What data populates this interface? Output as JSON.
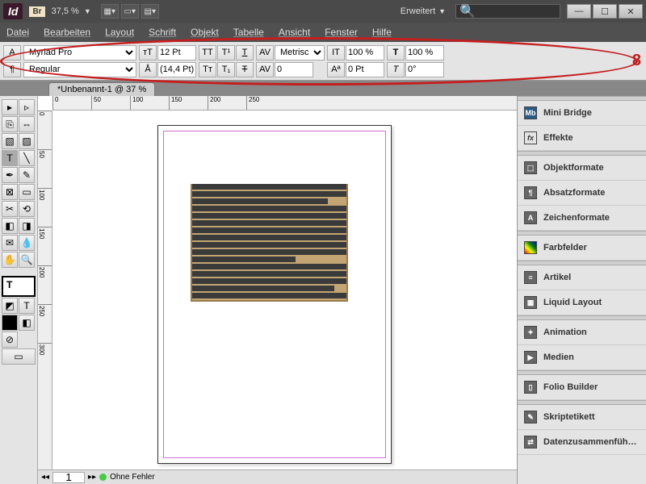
{
  "title": {
    "zoom": "37,5 %",
    "workspace": "Erweitert"
  },
  "menu": {
    "datei": "Datei",
    "bearbeiten": "Bearbeiten",
    "layout": "Layout",
    "schrift": "Schrift",
    "objekt": "Objekt",
    "tabelle": "Tabelle",
    "ansicht": "Ansicht",
    "fenster": "Fenster",
    "hilfe": "Hilfe"
  },
  "control": {
    "font": "Myriad Pro",
    "style": "Regular",
    "size": "12 Pt",
    "leading": "(14,4 Pt)",
    "kerning": "Metrisch",
    "tracking": "0",
    "hscale": "100 %",
    "vscale": "100 %",
    "baseline": "0 Pt",
    "skew": "0°",
    "annotation": "8"
  },
  "tab": {
    "name": "*Unbenannt-1 @ 37 %"
  },
  "ruler": {
    "h": [
      "0",
      "50",
      "100",
      "150",
      "200",
      "250"
    ],
    "v": [
      "0",
      "50",
      "100",
      "150",
      "200",
      "250",
      "300"
    ]
  },
  "status": {
    "page": "1",
    "errors": "Ohne Fehler"
  },
  "panels": {
    "minibridge": "Mini Bridge",
    "effekte": "Effekte",
    "objektformate": "Objektformate",
    "absatzformate": "Absatzformate",
    "zeichenformate": "Zeichenformate",
    "farbfelder": "Farbfelder",
    "artikel": "Artikel",
    "liquid": "Liquid Layout",
    "animation": "Animation",
    "medien": "Medien",
    "folio": "Folio Builder",
    "skript": "Skriptetikett",
    "daten": "Datenzusammenfüh…"
  }
}
